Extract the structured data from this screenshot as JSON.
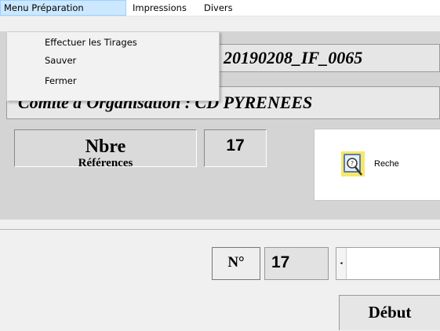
{
  "menu": {
    "items": [
      "Menu Préparation",
      "Impressions",
      "Divers"
    ],
    "open_menu": {
      "title": "Menu Préparation",
      "items": [
        "Effectuer les Tirages",
        "Sauver",
        "Fermer"
      ]
    }
  },
  "header": {
    "code": "20190208_IF_0065",
    "comite_line": "Comité d'Organisation : CD PYRENEES"
  },
  "stats": {
    "nbre_label": "Nbre",
    "nbre_sub": "Références",
    "nbre_value": "17"
  },
  "search_button": {
    "icon": "search-book-icon",
    "label": "Reche"
  },
  "detail": {
    "no_label": "N°",
    "no_value": "17",
    "arrow": "◂",
    "debut_header": "Début"
  },
  "colors": {
    "menu_highlight": "#cce8ff",
    "panel": "#d4d4d4"
  }
}
